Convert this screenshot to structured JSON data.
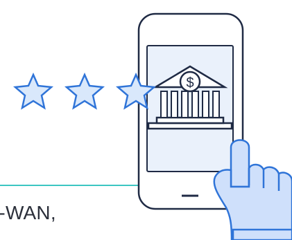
{
  "illustration": {
    "caption_text": "D-WAN,",
    "icons": {
      "stars": [
        "star-icon",
        "star-icon",
        "star-icon"
      ],
      "bank": "bank-icon",
      "dollar": "dollar-icon",
      "phone": "smartphone-icon",
      "hand": "pointing-hand-icon"
    },
    "colors": {
      "outline": "#1f2a44",
      "star_stroke": "#2f74d8",
      "star_fill": "#d9e8fb",
      "phone_screen": "#eaf1fb",
      "hand_fill": "#cfe0fb",
      "teal_line": "#3cc6c2"
    },
    "rating": {
      "stars_shown": 3
    }
  }
}
